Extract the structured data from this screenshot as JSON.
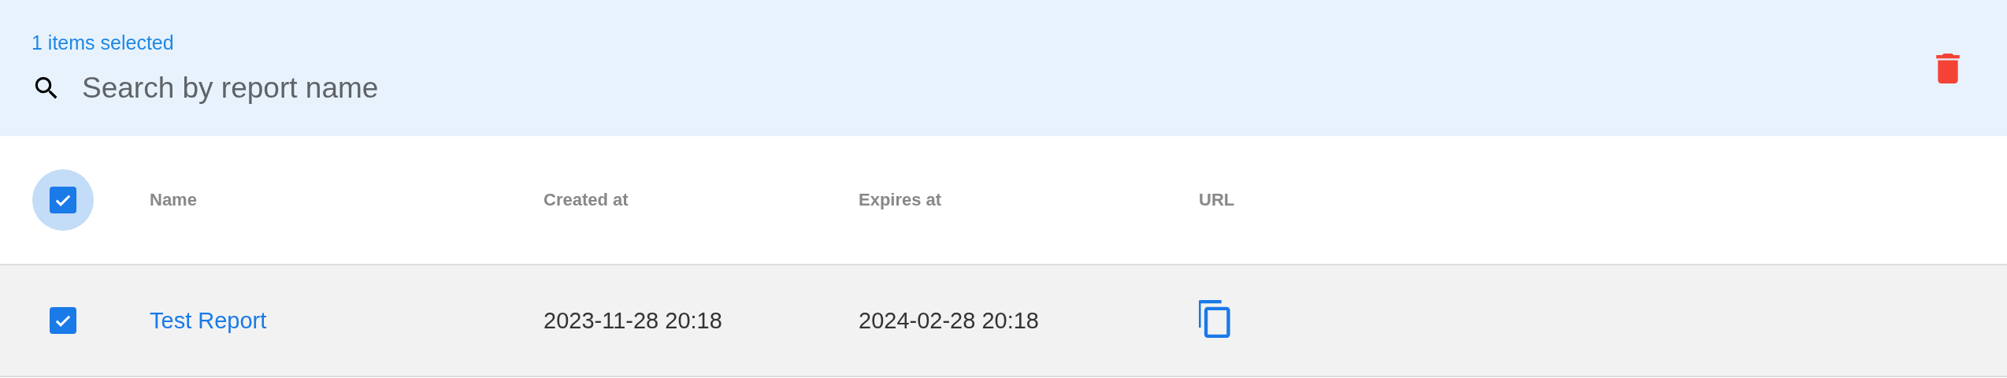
{
  "selection_bar": {
    "count_text": "1 items selected"
  },
  "search": {
    "placeholder": "Search by report name"
  },
  "table": {
    "select_all": {
      "checked": true
    },
    "columns": [
      "Name",
      "Created at",
      "Expires at",
      "URL"
    ],
    "rows": [
      {
        "selected": true,
        "name": "Test Report",
        "created_at": "2023-11-28 20:18",
        "expires_at": "2024-02-28 20:18"
      }
    ]
  }
}
